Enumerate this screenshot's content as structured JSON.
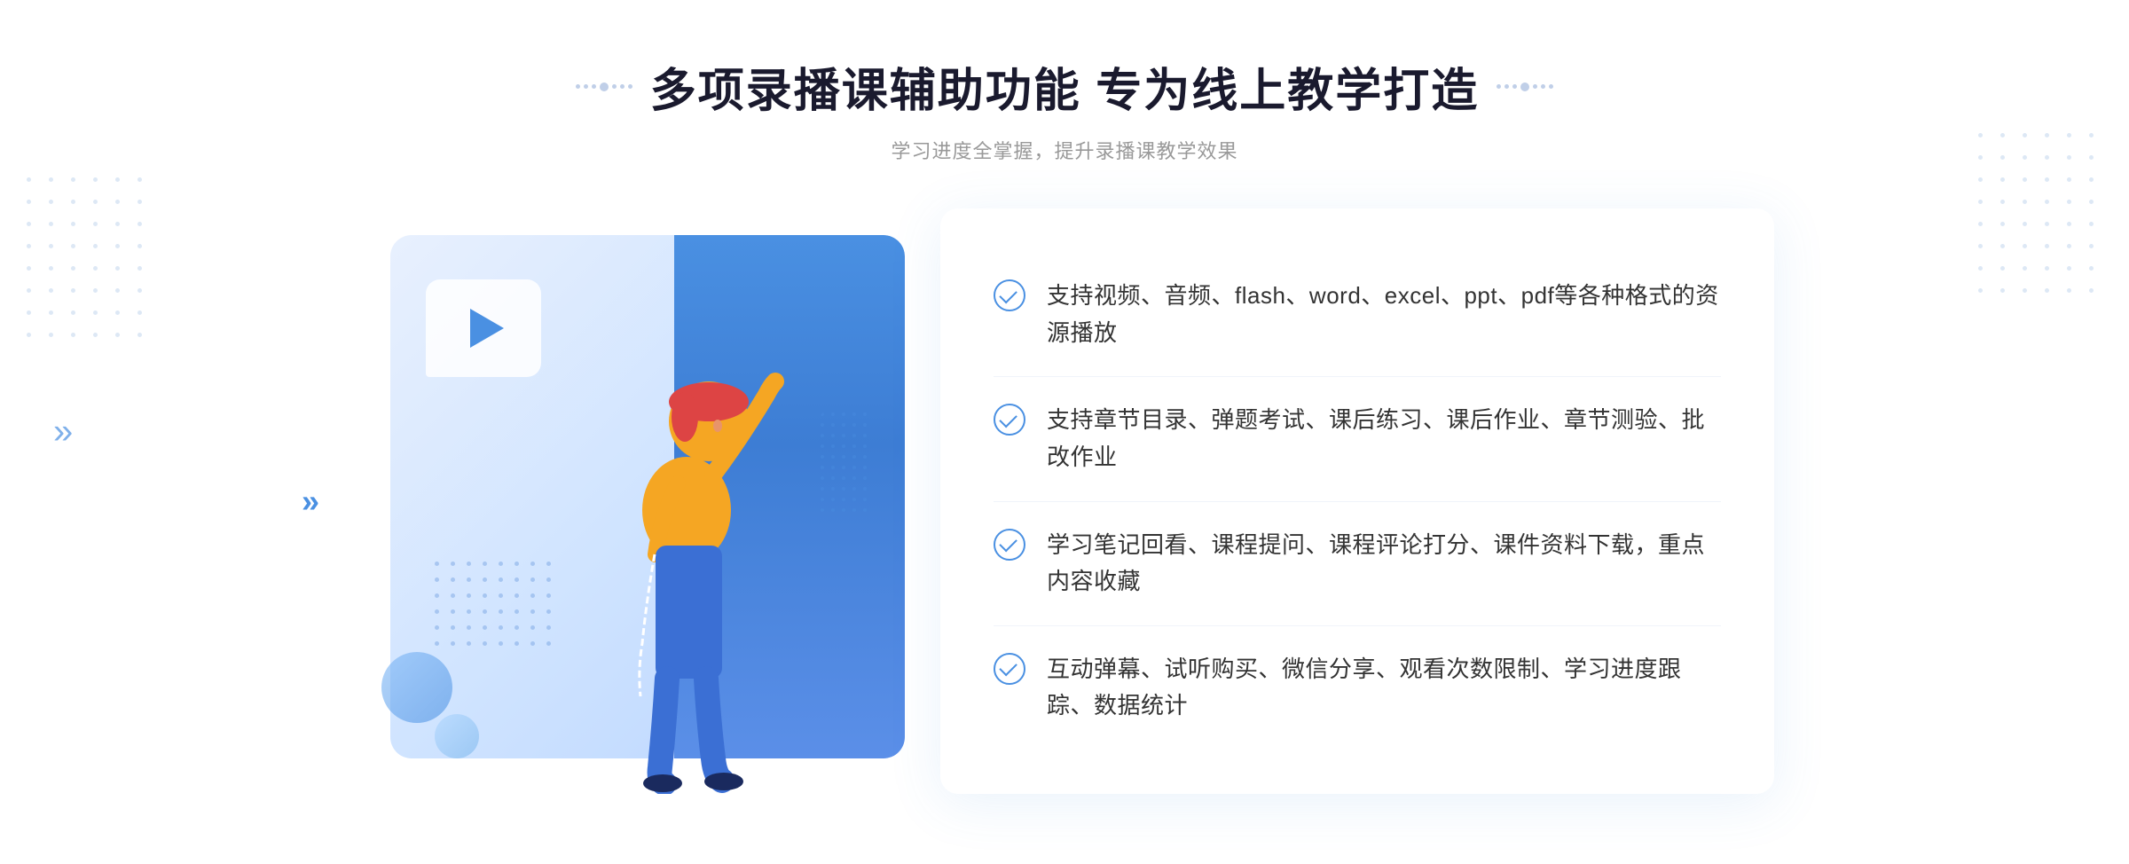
{
  "header": {
    "title": "多项录播课辅助功能 专为线上教学打造",
    "subtitle": "学习进度全掌握，提升录播课教学效果"
  },
  "features": [
    {
      "id": "feature-1",
      "text": "支持视频、音频、flash、word、excel、ppt、pdf等各种格式的资源播放"
    },
    {
      "id": "feature-2",
      "text": "支持章节目录、弹题考试、课后练习、课后作业、章节测验、批改作业"
    },
    {
      "id": "feature-3",
      "text": "学习笔记回看、课程提问、课程评论打分、课件资料下载，重点内容收藏"
    },
    {
      "id": "feature-4",
      "text": "互动弹幕、试听购买、微信分享、观看次数限制、学习进度跟踪、数据统计"
    }
  ],
  "decoration": {
    "left_arrow": "»",
    "title_dot": "·"
  }
}
